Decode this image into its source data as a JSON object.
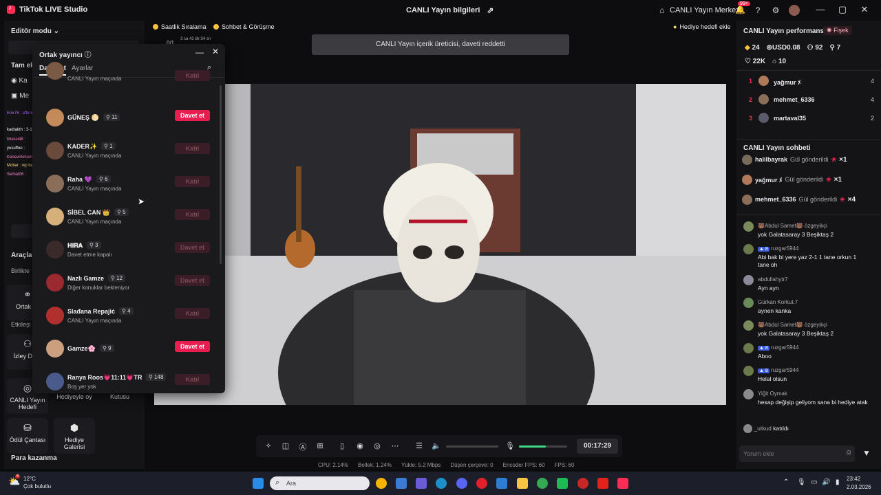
{
  "titlebar": {
    "app_name": "TikTok LIVE Studio",
    "center_title": "CANLI Yayın bilgileri",
    "live_center": "CANLI Yayın Merkezi",
    "notif_badge": "99+"
  },
  "left": {
    "mode": "Editör modu",
    "tam_ek": "Tam ek",
    "ka": "Ka",
    "me": "Me",
    "araclar": "Araçla",
    "birlikte": "Birlikte",
    "ortak": "Ortak ya",
    "etkilesim": "Etkileşi",
    "izleyici": "İzley Dilek",
    "canli_hedef": "CANLI Yayın Hedefi",
    "hediyeyle": "Hediyeyle oy",
    "hazine": "Kutusu",
    "odul": "Ödül Çantası",
    "hediye_galeri": "Hediye Galerisi",
    "para": "Para kazanma",
    "chat_overlay": [
      "Emr76 : afferin",
      "kadrakth : 3-1 bjk alacak görrr oyna bedava oranı al",
      "lmessi48 :",
      "yusuffoo :",
      "Kenevirtohumu :",
      "Mobar : wp bakar mısın @bakemask",
      "Serhat06 :"
    ]
  },
  "popup": {
    "title": "Ortak yayıncı",
    "tab_invite": "Davet et",
    "tab_settings": "Ayarlar",
    "rows": [
      {
        "name": "",
        "count": "",
        "sub": "CANLI Yayın maçında",
        "btn": "Katıl",
        "active": false
      },
      {
        "name": "GÜNEŞ 🌕",
        "count": "11",
        "sub": "",
        "btn": "Davet et",
        "active": true
      },
      {
        "name": "KADER✨",
        "count": "1",
        "sub": "CANLI Yayın maçında",
        "btn": "Katıl",
        "active": false
      },
      {
        "name": "Raha 💜",
        "count": "6",
        "sub": "CANLI Yayın maçında",
        "btn": "Katıl",
        "active": false
      },
      {
        "name": "SİBEL CAN 👑",
        "count": "5",
        "sub": "CANLI Yayın maçında",
        "btn": "Katıl",
        "active": false
      },
      {
        "name": "𝐇𝐢𝐑𝐀",
        "count": "3",
        "sub": "Davet etme kapalı",
        "btn": "Davet et",
        "active": false
      },
      {
        "name": "Nazlı Gamze",
        "count": "12",
        "sub": "Diğer konuklar bekleniyor",
        "btn": "Davet et",
        "active": false
      },
      {
        "name": "Slađana Repajić",
        "count": "4",
        "sub": "CANLI Yayın maçında",
        "btn": "Katıl",
        "active": false
      },
      {
        "name": "Gamze🌸",
        "count": "9",
        "sub": "",
        "btn": "Davet et",
        "active": true
      },
      {
        "name": "Ranya Roos💗11:11💗TR",
        "count": "148",
        "sub": "Boş yer yok",
        "btn": "Katıl",
        "active": false
      }
    ]
  },
  "top_pills": {
    "hourly": "Saatlik Sıralama",
    "chat": "Sohbet & Görüşme",
    "score": "0/1",
    "timer": "3 sa 42 dk 34 sn",
    "gift_goal": "Hediye hedefi ekle"
  },
  "notice": "CANLI Yayın içerik üreticisi, daveti reddetti",
  "controls": {
    "timer": "00:17:29",
    "volume_level": 0.55
  },
  "status": {
    "cpu": "CPU:  2.14%",
    "mem": "Bellek:  1.24%",
    "upload": "Yükle:  5.2 Mbps",
    "dropped": "Düşen çerçeve:  0",
    "encoder": "Encoder FPS:  60",
    "fps": "FPS:  60"
  },
  "right": {
    "perf_title": "CANLI Yayın performansı",
    "firecracker": "Fişek",
    "stats": {
      "coins": "24",
      "usd": "USD0.08",
      "viewers": "92",
      "new": "7",
      "likes": "22K",
      "gifts": "10"
    },
    "ranking": [
      {
        "rank": "1",
        "name": "yağmur ﾒ",
        "value": "4"
      },
      {
        "rank": "2",
        "name": "mehmet_6336",
        "value": "4"
      },
      {
        "rank": "3",
        "name": "martaval35",
        "value": "2"
      }
    ],
    "chat_title": "CANLI Yayın sohbeti",
    "gifts": [
      {
        "user": "halilbayrak",
        "action": "Gül gönderildi",
        "qty": "×1"
      },
      {
        "user": "yağmur ﾒ",
        "action": "Gül gönderildi",
        "qty": "×1"
      },
      {
        "user": "mehmet_6336",
        "action": "Gül gönderildi",
        "qty": "×4"
      }
    ],
    "messages": [
      {
        "user": "🐻Abdul Samet🐻  özgeyikçi",
        "text": "yok Galatasaray 3 Beşiktaş 2"
      },
      {
        "user": "ruzgar5944",
        "badge": "8",
        "text": "Abi bak bi yere yaz 2-1 1 tane orkun 1 tane oh"
      },
      {
        "user": "abdullahytr7",
        "text": "Ayn ayn"
      },
      {
        "user": "Gürkan Korkut.7",
        "text": "aynen kanka"
      },
      {
        "user": "🐻Abdul Samet🐻  özgeyikçi",
        "text": "yok Galatasaray 3 Beşiktaş 2"
      },
      {
        "user": "ruzgar5944",
        "badge": "8",
        "text": "Aboo"
      },
      {
        "user": "ruzgar5944",
        "badge": "8",
        "text": "Helal olsun"
      },
      {
        "user": "Yiğit Oymak",
        "text": "hesap değişip geliyom sana bi hediye atak"
      }
    ],
    "joined_user": "_utkud",
    "joined_text": "katıldı",
    "comment_placeholder": "Yorum ekle"
  },
  "taskbar": {
    "temp": "12°C",
    "weather": "Çok bulutlu",
    "weather_badge": "6",
    "search": "Ara",
    "time": "23:42",
    "date": "2.03.2026"
  }
}
